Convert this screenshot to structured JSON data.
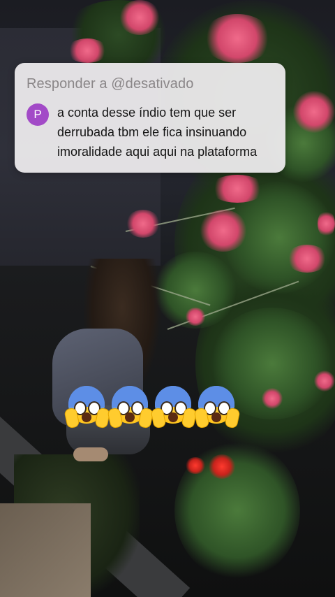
{
  "reply": {
    "header": "Responder a @desativado",
    "avatar_letter": "P",
    "avatar_color": "#a24ac7",
    "comment_lines": [
      "a conta desse índio tem que ser",
      "derrubada tbm ele fica insinuando",
      "imoralidade aqui aqui na plataforma"
    ]
  },
  "emoji": {
    "name": "face-screaming-in-fear",
    "count": 4
  }
}
